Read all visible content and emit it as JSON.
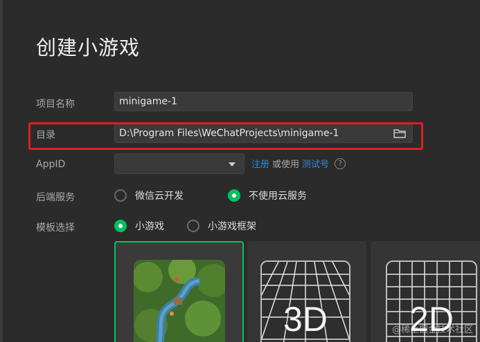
{
  "page": {
    "title": "创建小游戏"
  },
  "form": {
    "project_name": {
      "label": "项目名称",
      "value": "minigame-1"
    },
    "directory": {
      "label": "目录",
      "value": "D:\\Program Files\\WeChatProjects\\minigame-1",
      "icon": "folder-icon"
    },
    "appid": {
      "label": "AppID",
      "value": "",
      "register_link": "注册",
      "or_use": "或使用",
      "test_link": "测试号",
      "help_icon": "help-icon"
    },
    "backend": {
      "label": "后端服务",
      "options": [
        {
          "label": "微信云开发",
          "selected": false
        },
        {
          "label": "不使用云服务",
          "selected": true
        }
      ]
    },
    "template": {
      "label": "模板选择",
      "options": [
        {
          "label": "小游戏",
          "selected": true
        },
        {
          "label": "小游戏框架",
          "selected": false
        }
      ],
      "cards": [
        {
          "name": "game-map-template",
          "selected": true
        },
        {
          "name": "3d-template",
          "text": "3D"
        },
        {
          "name": "2d-template",
          "text": "2D"
        }
      ]
    }
  },
  "watermark": "@稀土掘金技术社区",
  "colors": {
    "accent": "#07c160",
    "link": "#2f87d6",
    "highlight": "#e02020",
    "background": "#2b2b2b"
  }
}
